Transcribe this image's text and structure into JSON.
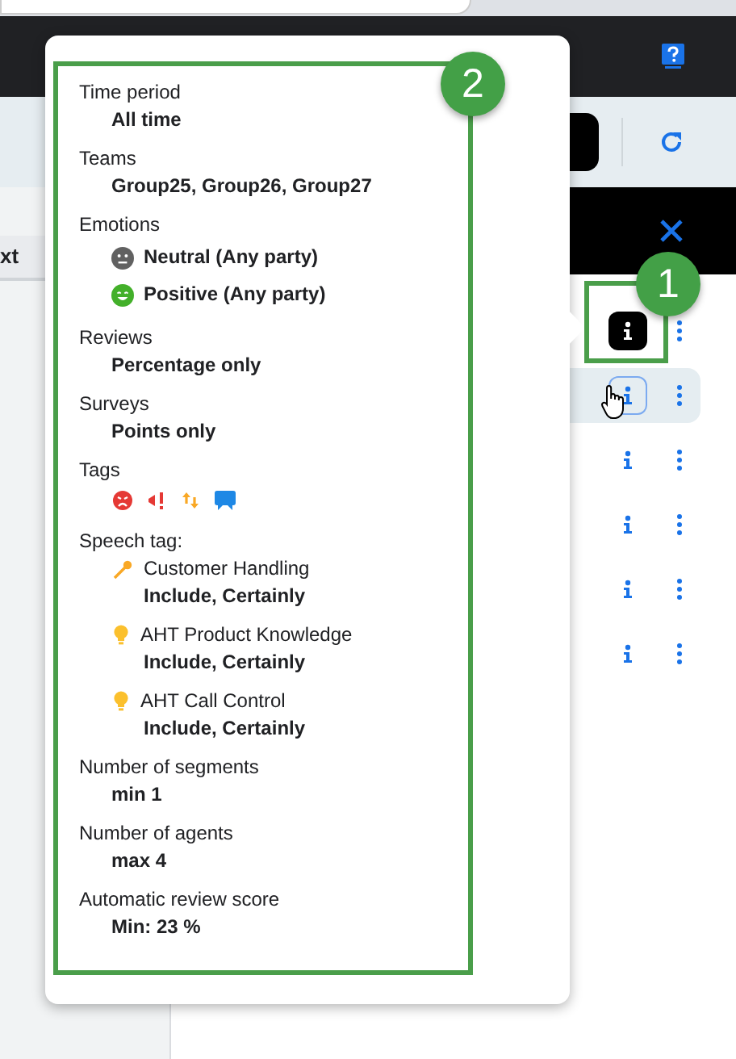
{
  "sidebar": {
    "tab": "xt"
  },
  "rows": [
    {
      "info_active": true,
      "hovered": false
    },
    {
      "info_active": false,
      "hovered": true
    },
    {
      "info_active": false,
      "hovered": false
    },
    {
      "info_active": false,
      "hovered": false
    },
    {
      "info_active": false,
      "hovered": false
    },
    {
      "info_active": false,
      "hovered": false
    }
  ],
  "filter_summary": {
    "sections": [
      {
        "kind": "text",
        "label": "Time period",
        "value": "All time"
      },
      {
        "kind": "text",
        "label": "Teams",
        "value": "Group25, Group26, Group27"
      },
      {
        "kind": "emotions",
        "label": "Emotions",
        "items": [
          {
            "kind": "neutral",
            "text": "Neutral (Any party)"
          },
          {
            "kind": "positive",
            "text": "Positive (Any party)"
          }
        ]
      },
      {
        "kind": "text",
        "label": "Reviews",
        "value": "Percentage only"
      },
      {
        "kind": "text",
        "label": "Surveys",
        "value": "Points only"
      },
      {
        "kind": "tags",
        "label": "Tags",
        "tags": [
          {
            "kind": "angry"
          },
          {
            "kind": "alert"
          },
          {
            "kind": "transfer"
          },
          {
            "kind": "chat"
          }
        ]
      },
      {
        "kind": "speech",
        "label": "Speech tag:",
        "items": [
          {
            "kind": "key",
            "name": "Customer Handling",
            "value": "Include, Certainly"
          },
          {
            "kind": "bulb",
            "name": "AHT Product Knowledge",
            "value": "Include, Certainly"
          },
          {
            "kind": "bulb",
            "name": "AHT Call Control",
            "value": "Include, Certainly"
          }
        ]
      },
      {
        "kind": "text",
        "label": "Number of segments",
        "value": "min 1"
      },
      {
        "kind": "text",
        "label": "Number of agents",
        "value": "max 4"
      },
      {
        "kind": "text",
        "label": "Automatic review score",
        "value": "Min: 23 %"
      }
    ]
  },
  "annotations": [
    {
      "number": "1"
    },
    {
      "number": "2"
    }
  ]
}
